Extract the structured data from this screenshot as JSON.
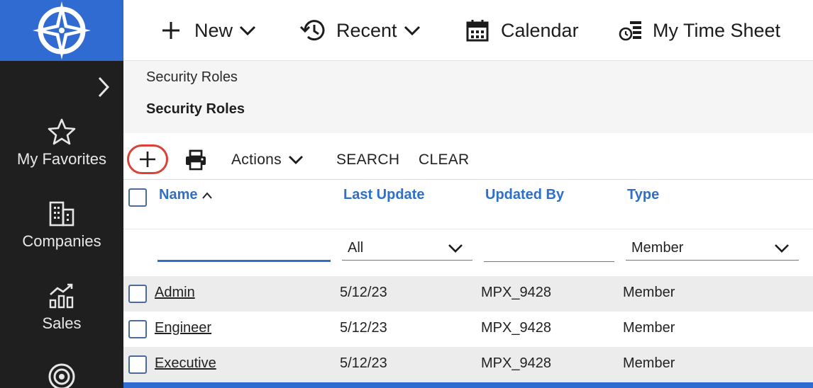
{
  "colors": {
    "sidebar_bg": "#1f1f1f",
    "brand": "#2f6bd1",
    "link": "#2e6fc9",
    "highlight_ring": "#d94235"
  },
  "topbar": {
    "new_label": "New",
    "recent_label": "Recent",
    "calendar_label": "Calendar",
    "timesheet_label": "My Time Sheet"
  },
  "sidebar": {
    "items": [
      {
        "label": "My Favorites",
        "icon": "star-icon"
      },
      {
        "label": "Companies",
        "icon": "building-icon"
      },
      {
        "label": "Sales",
        "icon": "sales-chart-icon"
      },
      {
        "label": "",
        "icon": "target-icon"
      }
    ]
  },
  "breadcrumb": {
    "parent": "Security Roles",
    "current": "Security Roles"
  },
  "toolbar": {
    "actions_label": "Actions",
    "search_label": "SEARCH",
    "clear_label": "CLEAR"
  },
  "table": {
    "columns": [
      "Name",
      "Last Update",
      "Updated By",
      "Type"
    ],
    "filters": {
      "name_value": "",
      "last_update_selected": "All",
      "updated_by_value": "",
      "type_selected": "Member"
    },
    "rows": [
      {
        "name": "Admin",
        "last_update": "5/12/23",
        "updated_by": "MPX_9428",
        "type": "Member"
      },
      {
        "name": "Engineer",
        "last_update": "5/12/23",
        "updated_by": "MPX_9428",
        "type": "Member"
      },
      {
        "name": "Executive",
        "last_update": "5/12/23",
        "updated_by": "MPX_9428",
        "type": "Member"
      }
    ]
  }
}
